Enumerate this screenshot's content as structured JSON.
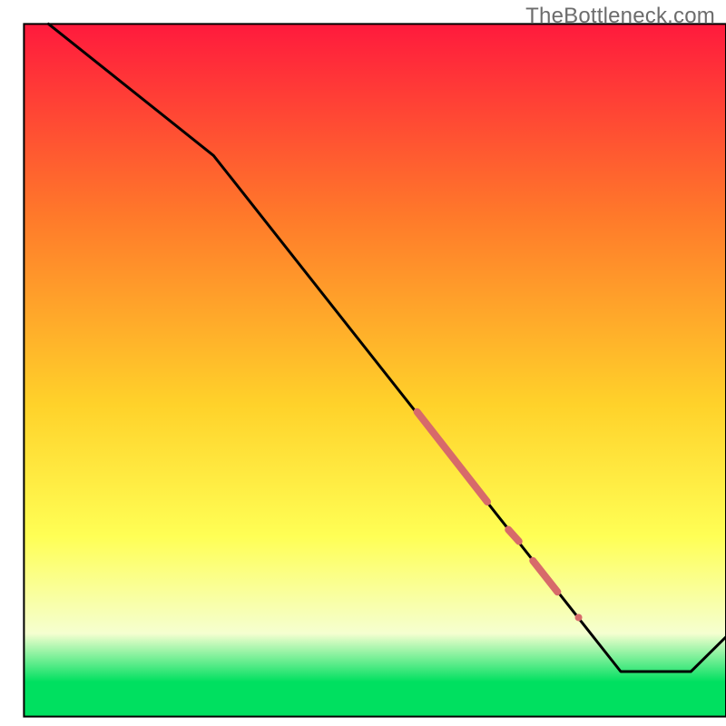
{
  "watermark": "TheBottleneck.com",
  "colors": {
    "gradient_top": "#ff1a3d",
    "gradient_mid1": "#ff7a2a",
    "gradient_mid2": "#ffd22a",
    "gradient_mid3": "#ffff55",
    "gradient_pale": "#f5ffd0",
    "gradient_green": "#00e060",
    "line": "#000000",
    "highlight": "#d76a6a",
    "border": "#000000"
  },
  "chart_data": {
    "type": "line",
    "title": "",
    "xlabel": "",
    "ylabel": "",
    "xlim": [
      0,
      100
    ],
    "ylim": [
      0,
      100
    ],
    "grid": false,
    "line_points": [
      {
        "x": 3.5,
        "y": 100.0
      },
      {
        "x": 27.0,
        "y": 81.0
      },
      {
        "x": 85.0,
        "y": 6.5
      },
      {
        "x": 95.0,
        "y": 6.5
      },
      {
        "x": 100.0,
        "y": 11.5
      }
    ],
    "highlight_segments": [
      {
        "x1": 56.0,
        "y1": 44.0,
        "x2": 66.0,
        "y2": 31.0,
        "thick": 8
      },
      {
        "x1": 69.0,
        "y1": 27.0,
        "x2": 70.5,
        "y2": 25.3,
        "thick": 8
      },
      {
        "x1": 72.5,
        "y1": 22.5,
        "x2": 76.0,
        "y2": 18.0,
        "thick": 8
      }
    ],
    "highlight_dots": [
      {
        "x": 79.0,
        "y": 14.3,
        "r": 4
      }
    ],
    "inner_box": {
      "x": 3.3,
      "y": 3.3,
      "w": 96.7,
      "h": 95.4
    }
  }
}
